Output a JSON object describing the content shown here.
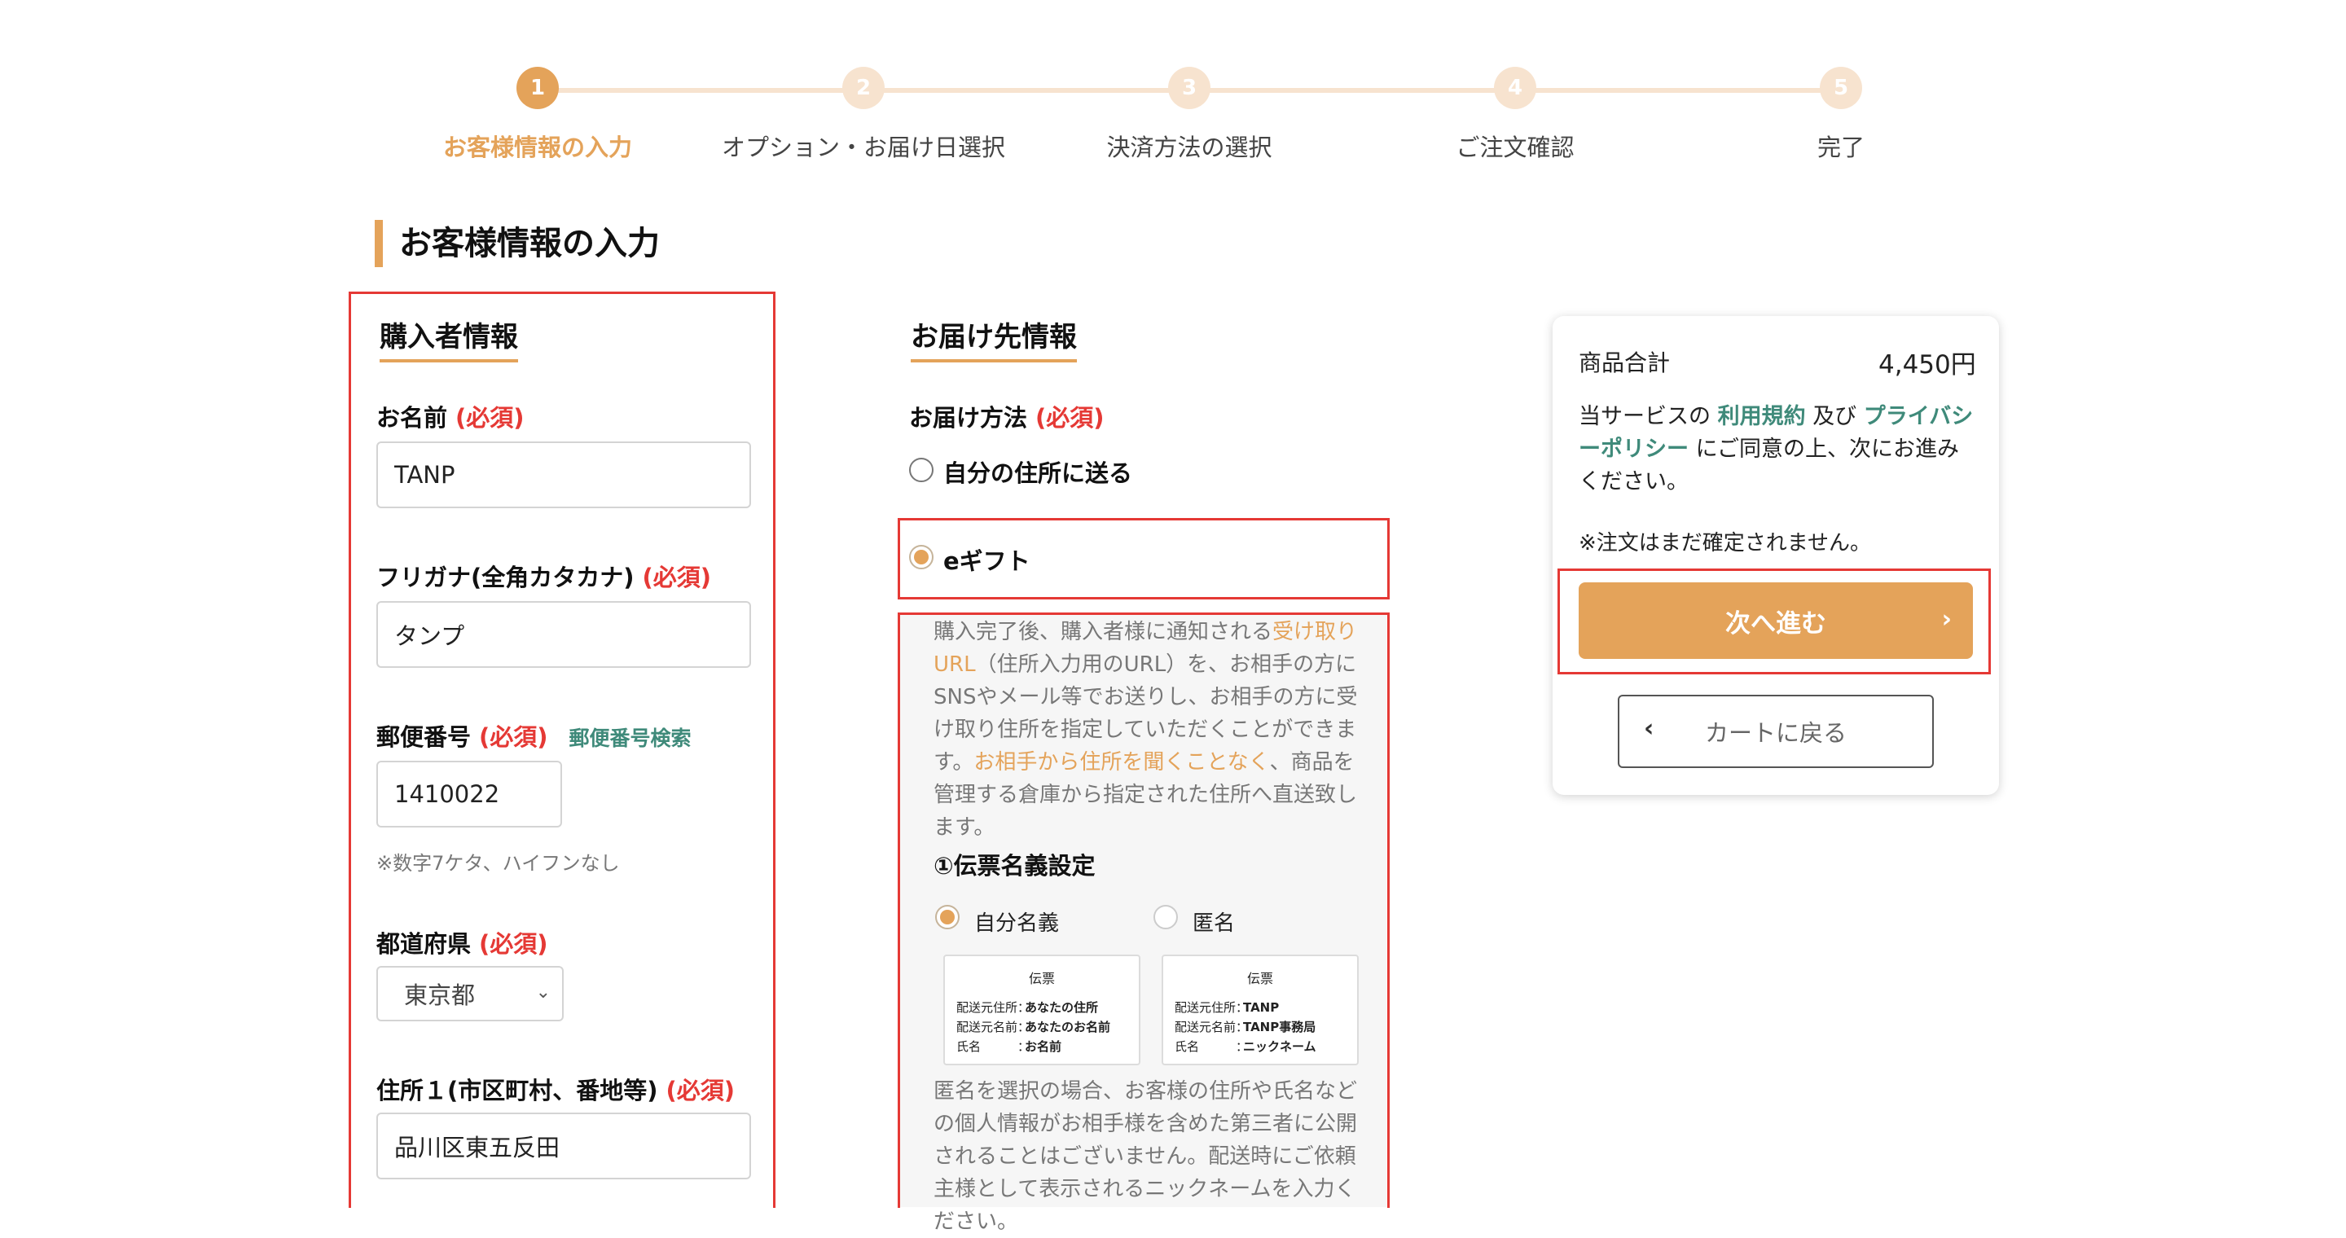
{
  "stepper": {
    "steps": [
      {
        "num": "1",
        "label": "お客様情報の入力"
      },
      {
        "num": "2",
        "label": "オプション・お届け日選択"
      },
      {
        "num": "3",
        "label": "決済方法の選択"
      },
      {
        "num": "4",
        "label": "ご注文確認"
      },
      {
        "num": "5",
        "label": "完了"
      }
    ],
    "active_index": 0
  },
  "page": {
    "title": "お客様情報の入力"
  },
  "buyer": {
    "heading": "購入者情報",
    "required": "(必須)",
    "name": {
      "label": "お名前",
      "value": "TANP"
    },
    "kana": {
      "label": "フリガナ(全角カタカナ)",
      "value": "タンプ"
    },
    "zip": {
      "label": "郵便番号",
      "search_link": "郵便番号検索",
      "value": "1410022",
      "hint": "※数字7ケタ、ハイフンなし"
    },
    "prefecture": {
      "label": "都道府県",
      "selected": "東京都"
    },
    "address1": {
      "label": "住所１(市区町村、番地等)",
      "value": "品川区東五反田"
    }
  },
  "delivery": {
    "heading": "お届け先情報",
    "method_label": "お届け方法",
    "required": "(必須)",
    "options": [
      "自分の住所に送る",
      "eギフト"
    ],
    "selected_option": "eギフト",
    "gift_desc": {
      "p1": "購入完了後、購入者様に通知される",
      "p2": "受け取りURL",
      "p3": "（住所入力用のURL）を、お相手の方にSNSやメール等でお送りし、お相手の方に受け取り住所を指定していただくことができます。",
      "p4": "お相手から住所を聞くことなく",
      "p5": "、商品を管理する倉庫から指定された住所へ直送致します。"
    },
    "slip_heading": "①伝票名義設定",
    "slip_options": [
      "自分名義",
      "匿名"
    ],
    "selected_slip": "自分名義",
    "slips": [
      {
        "title": "伝票",
        "rows": [
          {
            "k": "配送元住所：",
            "v": "あなたの住所"
          },
          {
            "k": "配送元名前：",
            "v": "あなたのお名前"
          },
          {
            "k": "氏名　　　：",
            "v": "お名前"
          }
        ]
      },
      {
        "title": "伝票",
        "rows": [
          {
            "k": "配送元住所：",
            "v": "TANP"
          },
          {
            "k": "配送元名前：",
            "v": "TANP事務局"
          },
          {
            "k": "氏名　　　：",
            "v": "ニックネーム"
          }
        ]
      }
    ],
    "anon_note": "匿名を選択の場合、お客様の住所や氏名などの個人情報がお相手様を含めた第三者に公開されることはございません。配送時にご依頼主様として表示されるニックネームを入力ください。"
  },
  "summary": {
    "subtotal_label": "商品合計",
    "subtotal_value": "4,450円",
    "terms_prefix": "当サービスの",
    "terms_link": "利用規約",
    "terms_and": "及び",
    "privacy_link": "プライバシーポリシー",
    "terms_suffix": "にご同意の上、次にお進みください。",
    "notice": "※注文はまだ確定されません。",
    "next_button": "次へ進む",
    "back_button": "カートに戻る"
  },
  "colors": {
    "accent": "#e4a35a",
    "required": "#e53935",
    "link": "#3f8a7a",
    "highlight_box": "#e53935"
  }
}
